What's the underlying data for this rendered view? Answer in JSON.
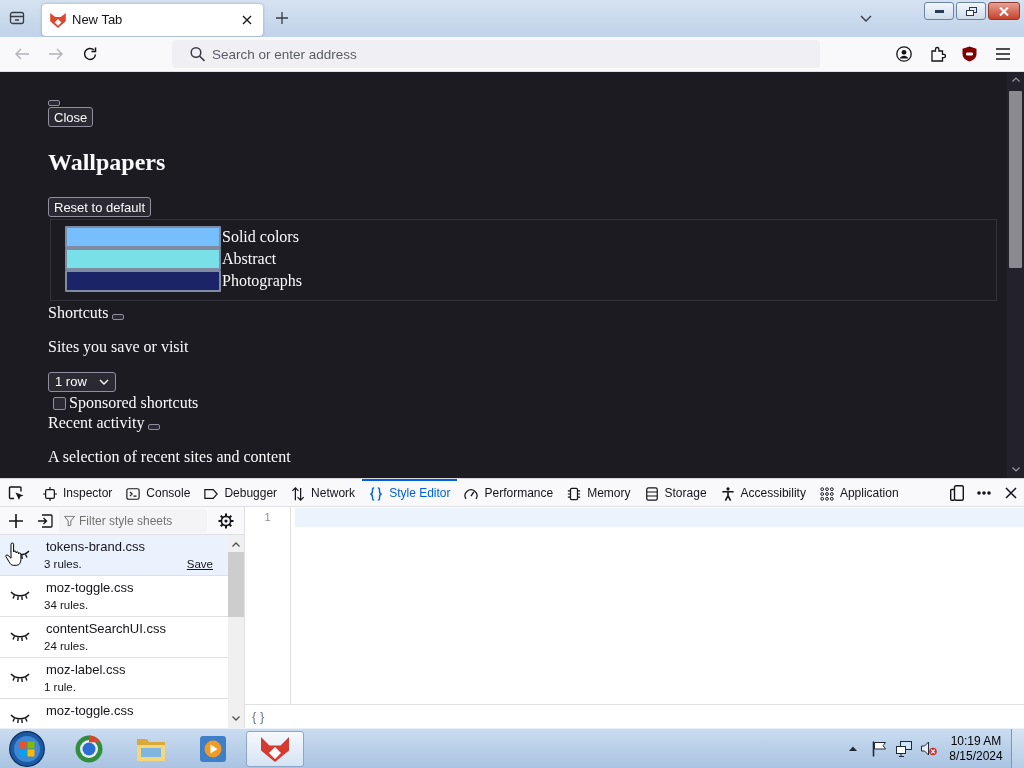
{
  "browser": {
    "tabs": [
      {
        "title": "New Tab",
        "selected": true
      }
    ],
    "nav_buttons": [
      {
        "kind": "back",
        "disabled": true
      },
      {
        "kind": "forward",
        "disabled": true
      },
      {
        "kind": "reload",
        "disabled": false
      }
    ],
    "address_bar": {
      "placeholder": "Search or enter address"
    }
  },
  "page": {
    "close_button": "Close",
    "heading": "Wallpapers",
    "reset_button": "Reset to default",
    "wallpaper_categories": [
      {
        "label": "Solid colors",
        "color": "#76bffc"
      },
      {
        "label": "Abstract",
        "color": "#78e0e6"
      },
      {
        "label": "Photographs",
        "color": "#1b2466"
      }
    ],
    "shortcuts": {
      "title": "Shortcuts",
      "description": "Sites you save or visit",
      "rows_select": {
        "value": "1 row"
      },
      "sponsored": {
        "label": "Sponsored shortcuts",
        "checked": false
      }
    },
    "recent_activity": {
      "title": "Recent activity",
      "description": "A selection of recent sites and content"
    }
  },
  "devtools": {
    "tabs": [
      {
        "kind": "inspector",
        "label": "Inspector",
        "selected": false
      },
      {
        "kind": "console",
        "label": "Console",
        "selected": false
      },
      {
        "kind": "debugger",
        "label": "Debugger",
        "selected": false
      },
      {
        "kind": "network",
        "label": "Network",
        "selected": false
      },
      {
        "kind": "style_editor",
        "label": "Style Editor",
        "selected": true
      },
      {
        "kind": "performance",
        "label": "Performance",
        "selected": false
      },
      {
        "kind": "memory",
        "label": "Memory",
        "selected": false
      },
      {
        "kind": "storage",
        "label": "Storage",
        "selected": false
      },
      {
        "kind": "accessibility",
        "label": "Accessibility",
        "selected": false
      },
      {
        "kind": "application",
        "label": "Application",
        "selected": false
      }
    ],
    "filter": {
      "placeholder": "Filter style sheets"
    },
    "style_sheets": [
      {
        "name": "tokens-brand.css",
        "rules": "3 rules.",
        "selected": true,
        "save": "Save"
      },
      {
        "name": "moz-toggle.css",
        "rules": "34 rules.",
        "selected": false
      },
      {
        "name": "contentSearchUI.css",
        "rules": "24 rules.",
        "selected": false
      },
      {
        "name": "moz-label.css",
        "rules": "1 rule.",
        "selected": false
      },
      {
        "name": "moz-toggle.css",
        "selected": false
      }
    ],
    "editor": {
      "line_numbers": [
        "1"
      ],
      "pretty_print": "{ }"
    }
  },
  "taskbar": {
    "apps": [
      {
        "kind": "ring",
        "selected": false
      },
      {
        "kind": "folder",
        "selected": false
      },
      {
        "kind": "player",
        "selected": false
      },
      {
        "kind": "fox",
        "selected": true
      }
    ],
    "clock": {
      "time": "10:19 AM",
      "date": "8/15/2024"
    }
  }
}
